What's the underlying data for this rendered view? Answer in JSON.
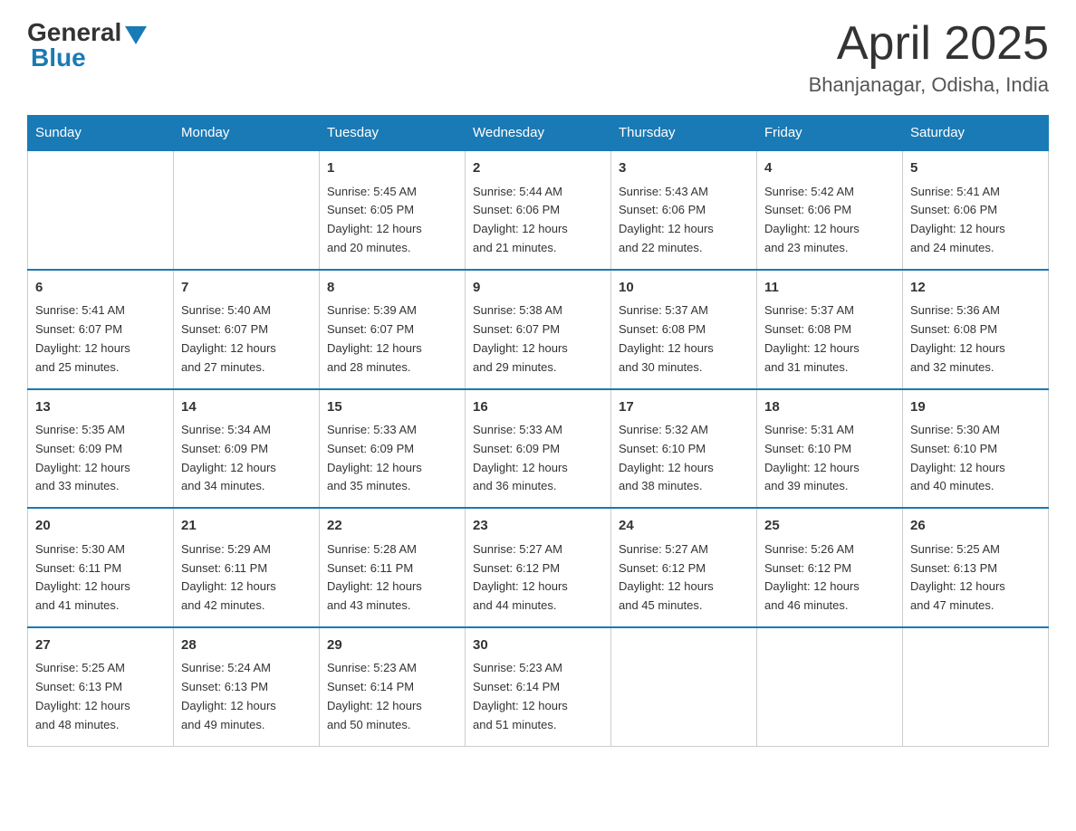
{
  "header": {
    "logo_general": "General",
    "logo_blue": "Blue",
    "month_title": "April 2025",
    "location": "Bhanjanagar, Odisha, India"
  },
  "days_of_week": [
    "Sunday",
    "Monday",
    "Tuesday",
    "Wednesday",
    "Thursday",
    "Friday",
    "Saturday"
  ],
  "weeks": [
    [
      {
        "day": "",
        "info": ""
      },
      {
        "day": "",
        "info": ""
      },
      {
        "day": "1",
        "info": "Sunrise: 5:45 AM\nSunset: 6:05 PM\nDaylight: 12 hours\nand 20 minutes."
      },
      {
        "day": "2",
        "info": "Sunrise: 5:44 AM\nSunset: 6:06 PM\nDaylight: 12 hours\nand 21 minutes."
      },
      {
        "day": "3",
        "info": "Sunrise: 5:43 AM\nSunset: 6:06 PM\nDaylight: 12 hours\nand 22 minutes."
      },
      {
        "day": "4",
        "info": "Sunrise: 5:42 AM\nSunset: 6:06 PM\nDaylight: 12 hours\nand 23 minutes."
      },
      {
        "day": "5",
        "info": "Sunrise: 5:41 AM\nSunset: 6:06 PM\nDaylight: 12 hours\nand 24 minutes."
      }
    ],
    [
      {
        "day": "6",
        "info": "Sunrise: 5:41 AM\nSunset: 6:07 PM\nDaylight: 12 hours\nand 25 minutes."
      },
      {
        "day": "7",
        "info": "Sunrise: 5:40 AM\nSunset: 6:07 PM\nDaylight: 12 hours\nand 27 minutes."
      },
      {
        "day": "8",
        "info": "Sunrise: 5:39 AM\nSunset: 6:07 PM\nDaylight: 12 hours\nand 28 minutes."
      },
      {
        "day": "9",
        "info": "Sunrise: 5:38 AM\nSunset: 6:07 PM\nDaylight: 12 hours\nand 29 minutes."
      },
      {
        "day": "10",
        "info": "Sunrise: 5:37 AM\nSunset: 6:08 PM\nDaylight: 12 hours\nand 30 minutes."
      },
      {
        "day": "11",
        "info": "Sunrise: 5:37 AM\nSunset: 6:08 PM\nDaylight: 12 hours\nand 31 minutes."
      },
      {
        "day": "12",
        "info": "Sunrise: 5:36 AM\nSunset: 6:08 PM\nDaylight: 12 hours\nand 32 minutes."
      }
    ],
    [
      {
        "day": "13",
        "info": "Sunrise: 5:35 AM\nSunset: 6:09 PM\nDaylight: 12 hours\nand 33 minutes."
      },
      {
        "day": "14",
        "info": "Sunrise: 5:34 AM\nSunset: 6:09 PM\nDaylight: 12 hours\nand 34 minutes."
      },
      {
        "day": "15",
        "info": "Sunrise: 5:33 AM\nSunset: 6:09 PM\nDaylight: 12 hours\nand 35 minutes."
      },
      {
        "day": "16",
        "info": "Sunrise: 5:33 AM\nSunset: 6:09 PM\nDaylight: 12 hours\nand 36 minutes."
      },
      {
        "day": "17",
        "info": "Sunrise: 5:32 AM\nSunset: 6:10 PM\nDaylight: 12 hours\nand 38 minutes."
      },
      {
        "day": "18",
        "info": "Sunrise: 5:31 AM\nSunset: 6:10 PM\nDaylight: 12 hours\nand 39 minutes."
      },
      {
        "day": "19",
        "info": "Sunrise: 5:30 AM\nSunset: 6:10 PM\nDaylight: 12 hours\nand 40 minutes."
      }
    ],
    [
      {
        "day": "20",
        "info": "Sunrise: 5:30 AM\nSunset: 6:11 PM\nDaylight: 12 hours\nand 41 minutes."
      },
      {
        "day": "21",
        "info": "Sunrise: 5:29 AM\nSunset: 6:11 PM\nDaylight: 12 hours\nand 42 minutes."
      },
      {
        "day": "22",
        "info": "Sunrise: 5:28 AM\nSunset: 6:11 PM\nDaylight: 12 hours\nand 43 minutes."
      },
      {
        "day": "23",
        "info": "Sunrise: 5:27 AM\nSunset: 6:12 PM\nDaylight: 12 hours\nand 44 minutes."
      },
      {
        "day": "24",
        "info": "Sunrise: 5:27 AM\nSunset: 6:12 PM\nDaylight: 12 hours\nand 45 minutes."
      },
      {
        "day": "25",
        "info": "Sunrise: 5:26 AM\nSunset: 6:12 PM\nDaylight: 12 hours\nand 46 minutes."
      },
      {
        "day": "26",
        "info": "Sunrise: 5:25 AM\nSunset: 6:13 PM\nDaylight: 12 hours\nand 47 minutes."
      }
    ],
    [
      {
        "day": "27",
        "info": "Sunrise: 5:25 AM\nSunset: 6:13 PM\nDaylight: 12 hours\nand 48 minutes."
      },
      {
        "day": "28",
        "info": "Sunrise: 5:24 AM\nSunset: 6:13 PM\nDaylight: 12 hours\nand 49 minutes."
      },
      {
        "day": "29",
        "info": "Sunrise: 5:23 AM\nSunset: 6:14 PM\nDaylight: 12 hours\nand 50 minutes."
      },
      {
        "day": "30",
        "info": "Sunrise: 5:23 AM\nSunset: 6:14 PM\nDaylight: 12 hours\nand 51 minutes."
      },
      {
        "day": "",
        "info": ""
      },
      {
        "day": "",
        "info": ""
      },
      {
        "day": "",
        "info": ""
      }
    ]
  ]
}
